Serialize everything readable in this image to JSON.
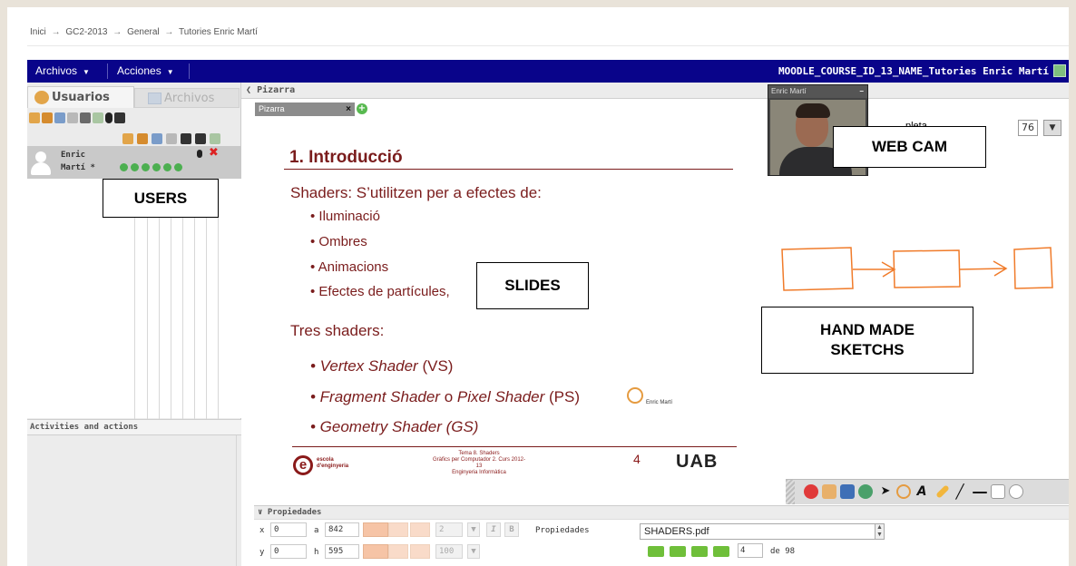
{
  "breadcrumb": [
    "Inici",
    "GC2-2013",
    "General",
    "Tutories Enric Martí"
  ],
  "breadcrumb_separator": "→",
  "menubar": {
    "archivos_label": "Archivos",
    "acciones_label": "Acciones",
    "course_title": "MOODLE_COURSE_ID_13_NAME_Tutories Enric Martí",
    "bg_color": "#09048a"
  },
  "left_panel": {
    "tab_users": "Usuarios",
    "tab_files": "Archivos",
    "user": {
      "name_line1": "Enric",
      "name_line2": "Martí *"
    },
    "activities_label": "Activities and actions"
  },
  "whiteboard": {
    "header": "Pizarra",
    "tab_label": "Pizarra",
    "tab_close": "×",
    "tab_add": "+"
  },
  "slide": {
    "title": "1. Introducció",
    "line1": "Shaders: S’utilitzen per a efectes de:",
    "bullets": [
      "• Iluminació",
      "• Ombres",
      "• Animacions",
      "• Efectes de partícules,"
    ],
    "line2": "Tres shaders:",
    "shaders": [
      {
        "italic": "• Vertex Shader",
        "plain": " (VS)"
      },
      {
        "italic": "• Fragment Shader",
        "plain": " o ",
        "italic2": "Pixel Shader",
        "plain2": " (PS)"
      },
      {
        "italic": "• Geometry Shader (GS)",
        "plain": ""
      }
    ],
    "footer": {
      "logo_letter": "e",
      "school": "escola d'enginyeria",
      "center_line1": "Tema 8. Shaders",
      "center_line2": "Gràfics per Computador 2. Curs 2012-13",
      "center_line3": "Enginyeria Informàtica",
      "page": "4",
      "uab": "UAB"
    },
    "accent_color": "#7a1c1c"
  },
  "annotations": {
    "users": "USERS",
    "slides": "SLIDES",
    "webcam": "WEB CAM",
    "sketch_line1": "HAND MADE",
    "sketch_line2": "SKETCHS"
  },
  "webcam": {
    "title": "Enric Martí",
    "minimize": "–"
  },
  "zoom": {
    "label": "pleta",
    "value": "76",
    "dropdown": "▼"
  },
  "cursor_label": "Enric Martí",
  "sketch_color": "#f07b2a",
  "properties": {
    "header": "Propiedades",
    "x_label": "x",
    "x_value": "0",
    "a_label": "a",
    "a_value": "842",
    "y_label": "y",
    "y_value": "0",
    "h_label": "h",
    "h_value": "595",
    "line_width": "2",
    "opacity": "100",
    "italic_btn": "I",
    "bold_btn": "B",
    "prop_label": "Propiedades",
    "file": "SHADERS.pdf",
    "page_value": "4",
    "page_total": "de 98"
  }
}
